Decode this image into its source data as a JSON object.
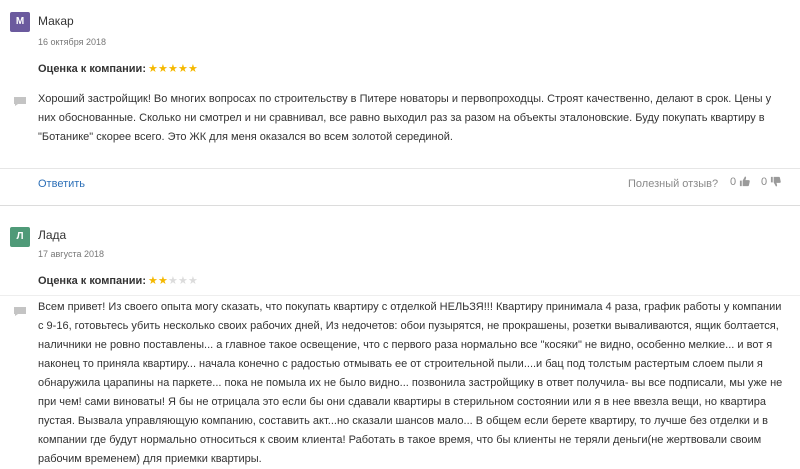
{
  "reviews": [
    {
      "avatar_letter": "М",
      "avatar_color": "#6b5a9e",
      "author": "Макар",
      "date": "16 октября 2018",
      "rating_label": "Оценка к компании:",
      "rating": 5,
      "text": "Хороший застройщик! Во многих вопросах по строительству в Питере новаторы и первопроходцы. Строят качественно, делают в срок. Цены у них обоснованные. Сколько ни смотрел и ни сравнивал, все равно выходил раз за разом на объекты эталоновские. Буду покупать квартиру в \"Ботанике\" скорее всего. Это ЖК для меня оказался во всем золотой серединой.",
      "reply_label": "Ответить",
      "useful_label": "Полезный отзыв?",
      "likes": "0",
      "dislikes": "0"
    },
    {
      "avatar_letter": "Л",
      "avatar_color": "#4f9a78",
      "author": "Лада",
      "date": "17 августа 2018",
      "rating_label": "Оценка к компании:",
      "rating": 2,
      "text": "Всем привет! Из своего опыта могу сказать, что покупать квартиру с отделкой НЕЛЬЗЯ!!! Квартиру принимала 4 раза, график работы у компании с 9-16, готовьтесь убить несколько своих рабочих дней, Из недочетов: обои пузырятся, не прокрашены, розетки вываливаются, ящик болтается, наличники не ровно поставлены... а главное такое освещение, что с первого раза нормально все \"косяки\" не видно, особенно мелкие... и вот я наконец то приняла квартиру... начала конечно с радостью отмывать ее от строительной пыли....и бац под толстым растертым слоем пыли я обнаружила царапины на паркете... пока не помыла их не было видно... позвонила застройщику в ответ получила- вы все подписали, мы уже не при чем! сами виноваты! Я бы не отрицала это если бы они сдавали квартиры в стерильном состоянии или я в нее ввезла вещи, но квартира пустая. Вызвала управляющую компанию, составить акт...но сказали шансов мало... В общем если берете квартиру, то лучше без отделки и в компании где будут нормально относиться к своим клиента! Работать в такое время, что бы клиенты не теряли деньги(не жертвовали своим рабочим временем) для приемки квартиры."
    }
  ]
}
